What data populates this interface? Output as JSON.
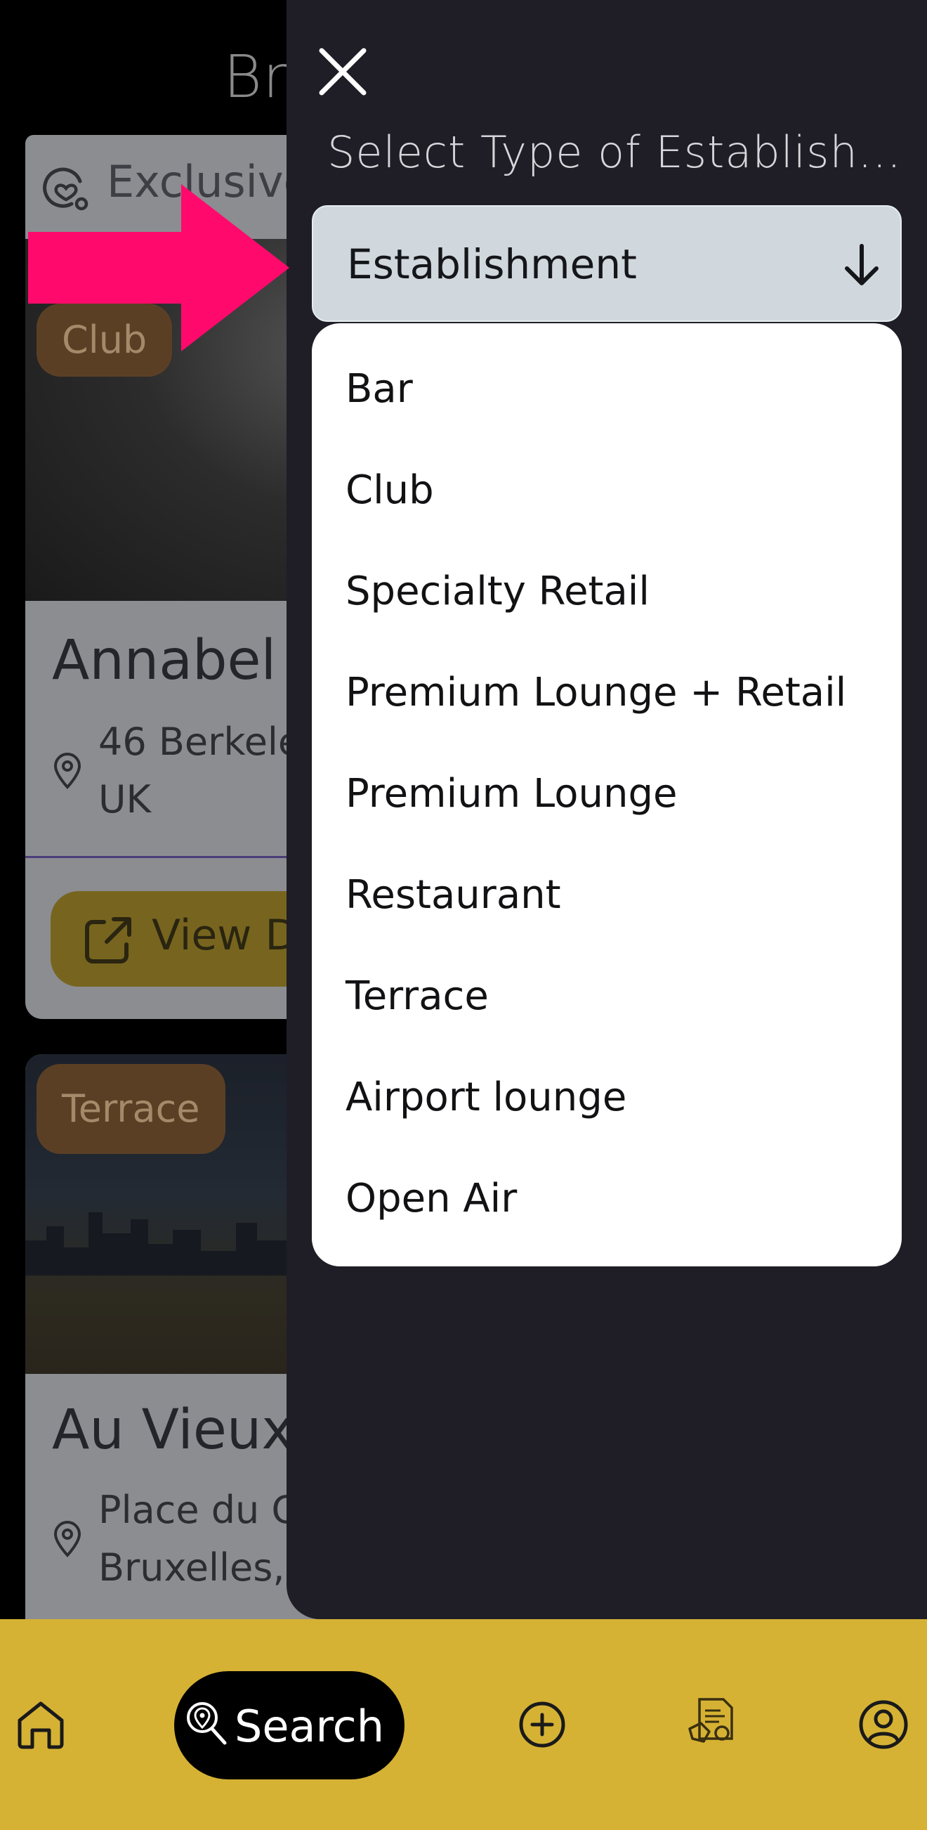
{
  "background_page": {
    "title": "Bro",
    "filter_chip": {
      "label": "Exclusive",
      "icon": "heart-circle-icon"
    },
    "cards": [
      {
        "tag": "Club",
        "name": "Annabel",
        "address_lines": [
          "46 Berkele",
          "UK"
        ],
        "view_label": "View D"
      },
      {
        "tag": "Terrace",
        "name": "Au Vieux",
        "address_lines": [
          "Place du C",
          "Bruxelles,"
        ]
      }
    ]
  },
  "drawer": {
    "title": "Select Type of Establish...",
    "select": {
      "value": "Establishment"
    },
    "options": [
      "Bar",
      "Club",
      "Specialty Retail",
      "Premium Lounge + Retail",
      "Premium Lounge",
      "Restaurant",
      "Terrace",
      "Airport lounge",
      "Open Air"
    ]
  },
  "bottom_nav": {
    "search_label": "Search",
    "items": [
      "home-icon",
      "search-icon",
      "add-circle-icon",
      "deals-icon",
      "profile-icon"
    ]
  },
  "colors": {
    "drawer_bg": "#1f1e26",
    "select_bg": "#d0d8dd",
    "nav_bg": "#d6b234",
    "annotation_arrow": "#ff0a6c"
  }
}
